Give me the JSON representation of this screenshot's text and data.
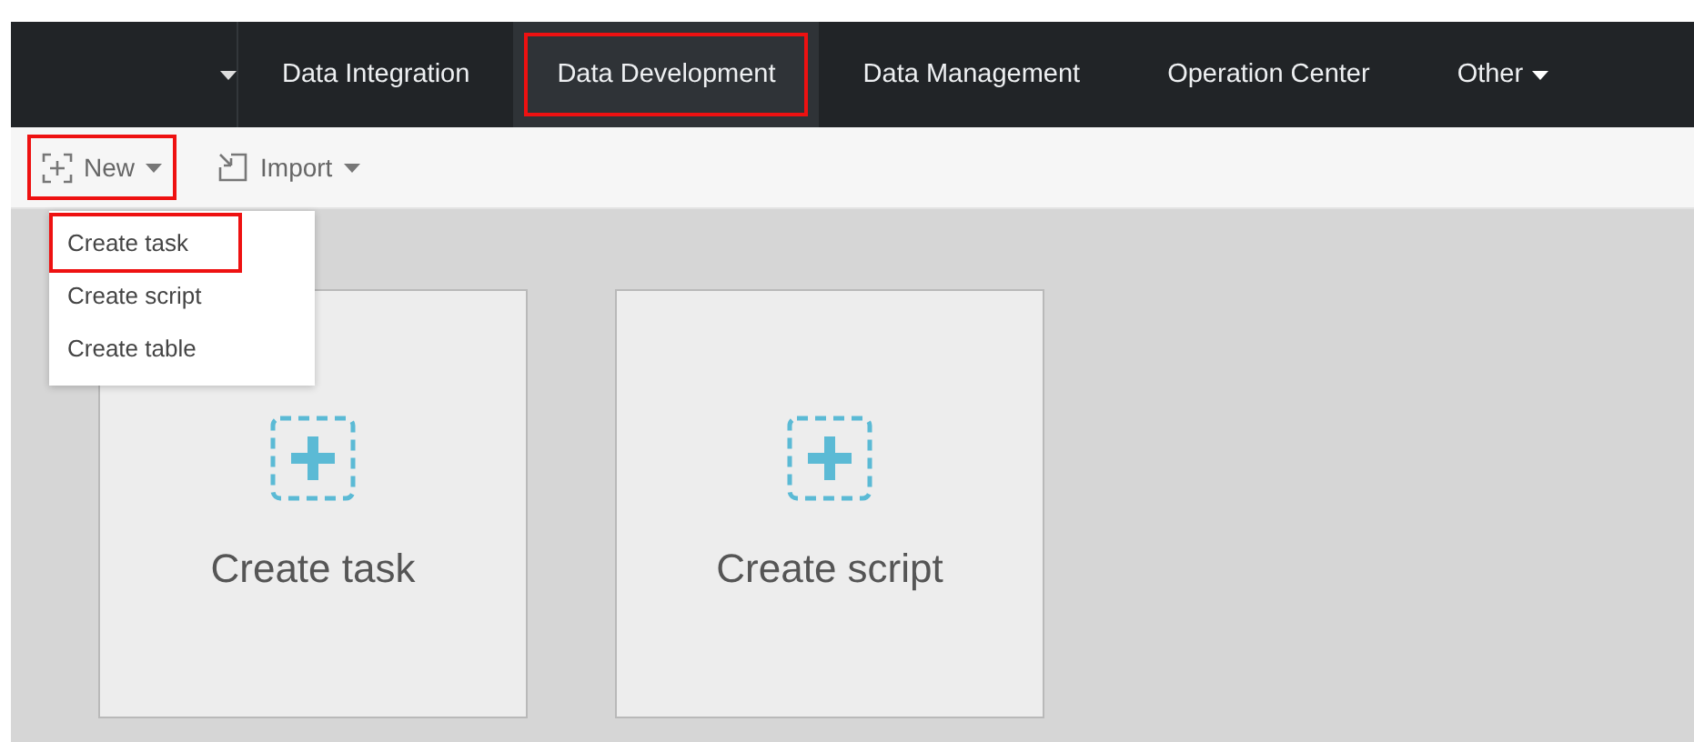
{
  "nav": {
    "items": [
      {
        "label": "Data Integration",
        "selected": false,
        "highlighted": false
      },
      {
        "label": "Data Development",
        "selected": true,
        "highlighted": true
      },
      {
        "label": "Data Management",
        "selected": false,
        "highlighted": false
      },
      {
        "label": "Operation Center",
        "selected": false,
        "highlighted": false
      },
      {
        "label": "Other",
        "selected": false,
        "highlighted": false,
        "dropdown": true
      }
    ]
  },
  "toolbar": {
    "buttons": [
      {
        "kind": "new",
        "label": "New",
        "highlighted": true
      },
      {
        "kind": "import",
        "label": "Import",
        "highlighted": false
      }
    ]
  },
  "menu": {
    "items": [
      {
        "label": "Create task",
        "highlighted": true
      },
      {
        "label": "Create script",
        "highlighted": false
      },
      {
        "label": "Create table",
        "highlighted": false
      }
    ]
  },
  "cards": [
    {
      "label": "Create task"
    },
    {
      "label": "Create script"
    }
  ]
}
